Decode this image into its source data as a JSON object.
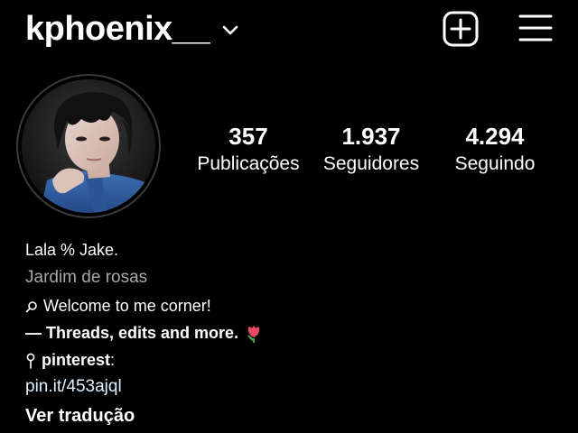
{
  "header": {
    "username": "kphoenix__",
    "chevron_icon": "chevron-down-icon",
    "add_icon": "plus-square-icon",
    "menu_icon": "hamburger-menu-icon"
  },
  "avatar": {
    "icon": "profile-photo"
  },
  "stats": {
    "posts": {
      "value": "357",
      "label": "Publicações"
    },
    "followers": {
      "value": "1.937",
      "label": "Seguidores"
    },
    "following": {
      "value": "4.294",
      "label": "Seguindo"
    }
  },
  "bio": {
    "name": "Lala % Jake.",
    "category": "Jardim de rosas",
    "line1_icon": "search-icon",
    "line1": "Welcome to me corner!",
    "line2": "— Threads, edits and more.",
    "line2_emoji": "tulip-emoji",
    "line3_icon": "pin-icon",
    "line3_bold": "pinterest",
    "line3_rest": ":",
    "link": "pin.it/453ajql",
    "translate": "Ver tradução"
  },
  "colors": {
    "background": "#000000",
    "text": "#ffffff",
    "secondary": "#a8a8a8",
    "link": "#e0f1ff"
  }
}
